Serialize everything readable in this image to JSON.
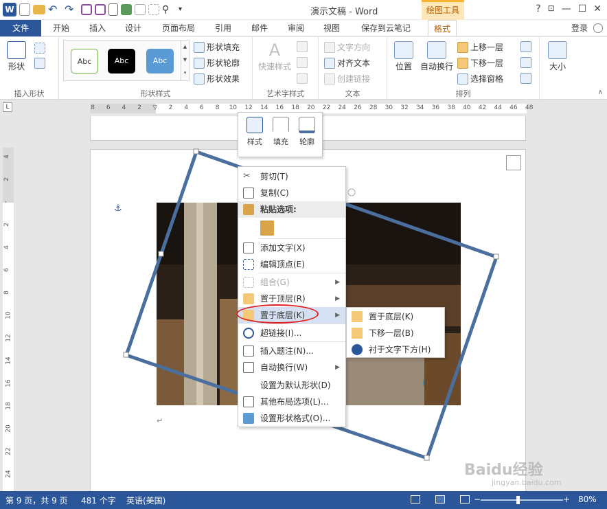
{
  "titlebar": {
    "title": "演示文稿 - Word",
    "context_tab": "绘图工具",
    "win_help": "?",
    "win_min": "—",
    "win_max": "☐",
    "win_close": "✕"
  },
  "tabs": {
    "file": "文件",
    "items": [
      "开始",
      "插入",
      "设计",
      "页面布局",
      "引用",
      "邮件",
      "审阅",
      "视图",
      "保存到云笔记"
    ],
    "active": "格式",
    "login": "登录"
  },
  "ribbon": {
    "insert_shapes": {
      "shape_btn": "形状",
      "label": "插入形状"
    },
    "shape_styles": {
      "abc1": "Abc",
      "abc2": "Abc",
      "abc3": "Abc",
      "fill": "形状填充",
      "outline": "形状轮廓",
      "effects": "形状效果",
      "label": "形状样式"
    },
    "wordart": {
      "quick_styles": "快速样式",
      "label": "艺术字样式"
    },
    "text": {
      "direction": "文字方向",
      "align": "对齐文本",
      "link": "创建链接",
      "label": "文本"
    },
    "arrange": {
      "position": "位置",
      "wrap": "自动换行",
      "forward": "上移一层",
      "backward": "下移一层",
      "pane": "选择窗格",
      "label": "排列"
    },
    "size": {
      "label": "大小"
    }
  },
  "ruler": {
    "h_ticks": [
      "8",
      "6",
      "4",
      "2",
      "",
      "2",
      "4",
      "6",
      "8",
      "10",
      "12",
      "14",
      "16",
      "18",
      "20",
      "22",
      "24",
      "26",
      "28",
      "30",
      "32",
      "34",
      "36",
      "38",
      "40",
      "42",
      "44",
      "46",
      "48"
    ],
    "v_ticks": [
      "4",
      "2",
      "",
      "2",
      "4",
      "6",
      "8",
      "10",
      "12",
      "14",
      "16",
      "18",
      "20",
      "22",
      "24"
    ]
  },
  "minibar": {
    "style": "样式",
    "fill": "填充",
    "outline": "轮廓"
  },
  "context_menu": {
    "cut": "剪切(T)",
    "copy": "复制(C)",
    "paste_header": "粘贴选项:",
    "add_text": "添加文字(X)",
    "edit_points": "编辑顶点(E)",
    "group": "组合(G)",
    "bring_front": "置于顶层(R)",
    "send_back": "置于底层(K)",
    "hyperlink": "超链接(I)...",
    "caption": "插入题注(N)...",
    "wrap": "自动换行(W)",
    "set_default": "设置为默认形状(D)",
    "more_layout": "其他布局选项(L)...",
    "format_shape": "设置形状格式(O)..."
  },
  "submenu": {
    "send_to_back": "置于底层(K)",
    "send_backward": "下移一层(B)",
    "behind_text": "衬于文字下方(H)"
  },
  "statusbar": {
    "page": "第 9 页，共 9 页",
    "words": "481 个字",
    "lang": "英语(美国)",
    "zoom_minus": "−",
    "zoom_plus": "+",
    "zoom": "80%"
  },
  "watermark": {
    "brand": "Baidu经验",
    "url": "jingyan.baidu.com"
  },
  "colors": {
    "accent": "#2b579a",
    "context_tab": "#f8b230",
    "shape_outline": "#4a6f9e",
    "highlight": "#d5e1f2",
    "annotation": "#e02020"
  }
}
